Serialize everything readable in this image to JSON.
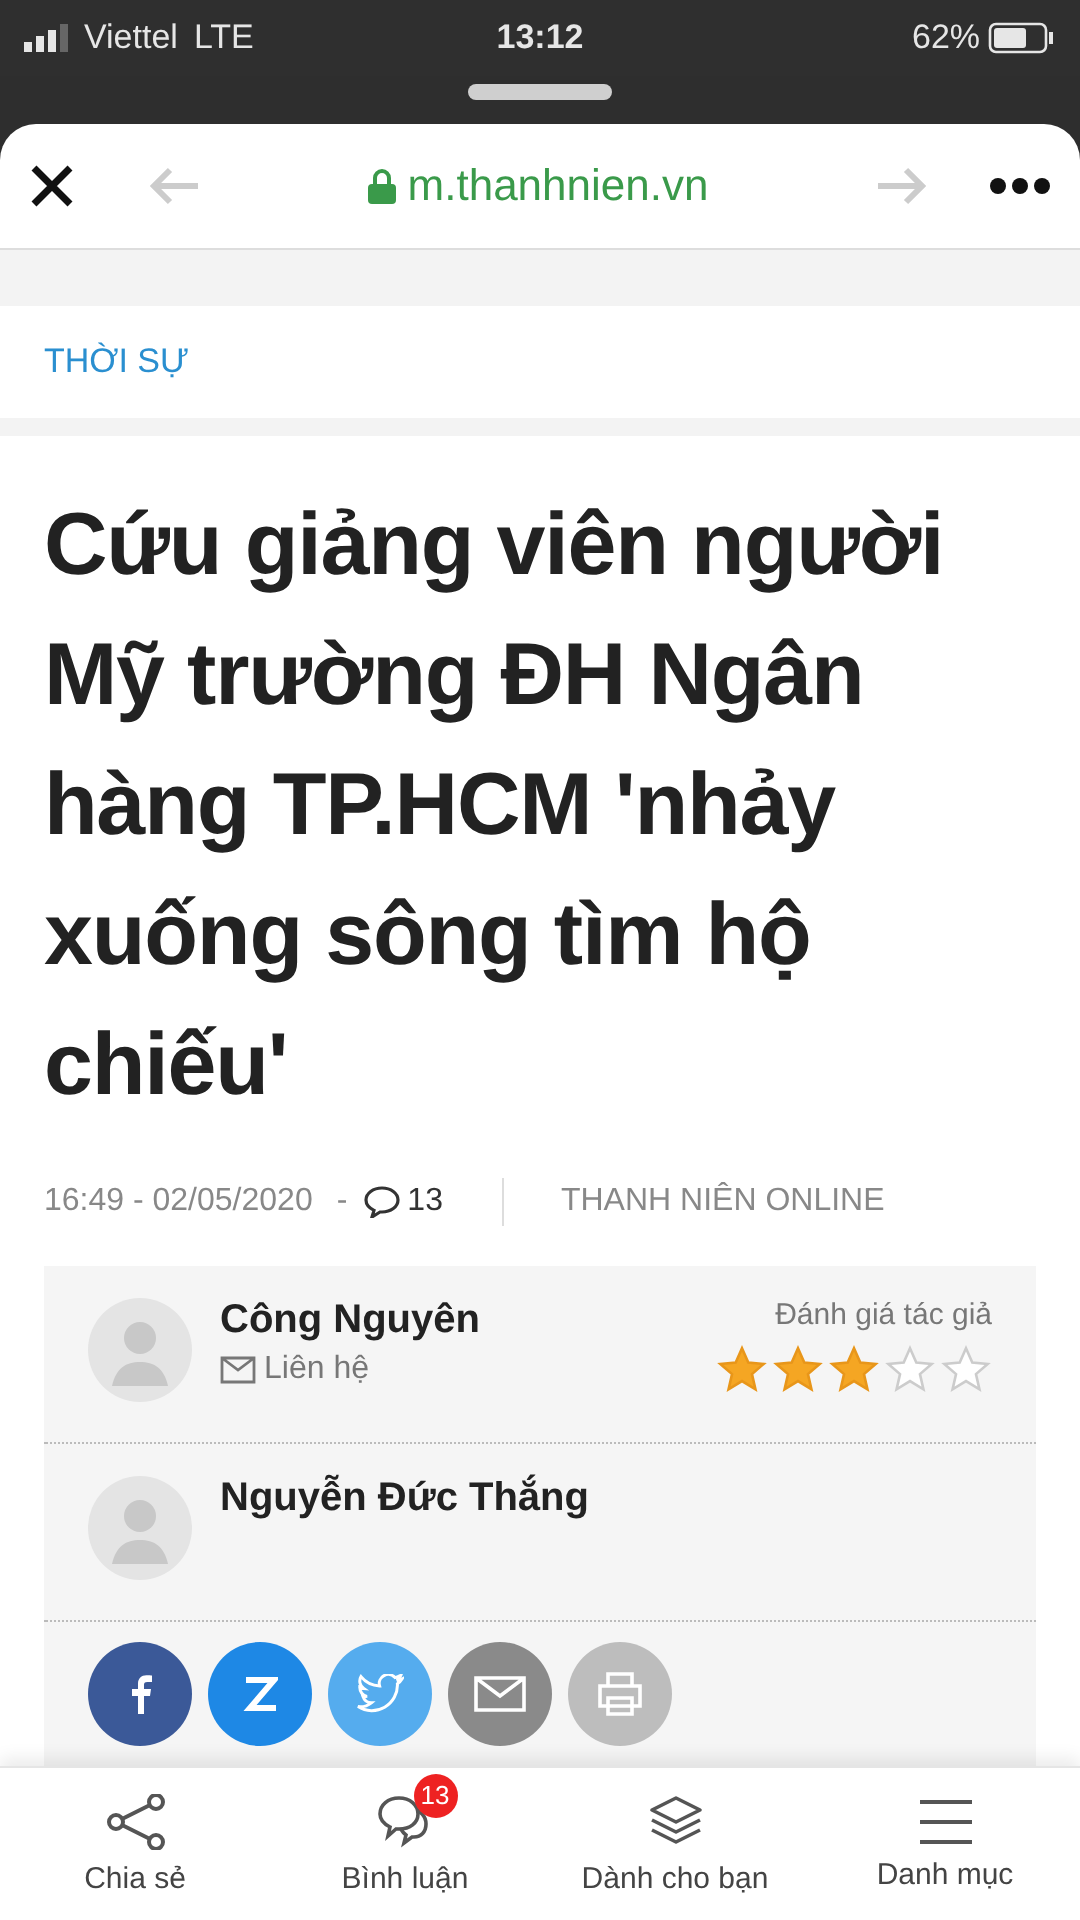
{
  "status_bar": {
    "carrier": "Viettel",
    "network": "LTE",
    "time": "13:12",
    "battery": "62%"
  },
  "browser": {
    "url": "m.thanhnien.vn"
  },
  "article": {
    "category": "THỜI SỰ",
    "title": "Cứu giảng viên người Mỹ trường ĐH Ngân hàng TP.HCM 'nhảy xuống sông tìm hộ chiếu'",
    "timestamp": "16:49 - 02/05/2020",
    "separator": "-",
    "comment_count": "13",
    "source": "THANH NIÊN ONLINE"
  },
  "authors": [
    {
      "name": "Công Nguyên",
      "contact": "Liên hệ",
      "rating_label": "Đánh giá tác giả",
      "stars": 3
    },
    {
      "name": "Nguyễn Đức Thắng"
    }
  ],
  "share_buttons": [
    {
      "kind": "facebook"
    },
    {
      "kind": "zalo"
    },
    {
      "kind": "twitter"
    },
    {
      "kind": "email"
    },
    {
      "kind": "print"
    }
  ],
  "bottom_nav": [
    {
      "kind": "share",
      "label": "Chia sẻ"
    },
    {
      "kind": "comments",
      "label": "Bình luận",
      "badge": "13"
    },
    {
      "kind": "layers",
      "label": "Dành cho bạn"
    },
    {
      "kind": "menu",
      "label": "Danh mục"
    }
  ]
}
